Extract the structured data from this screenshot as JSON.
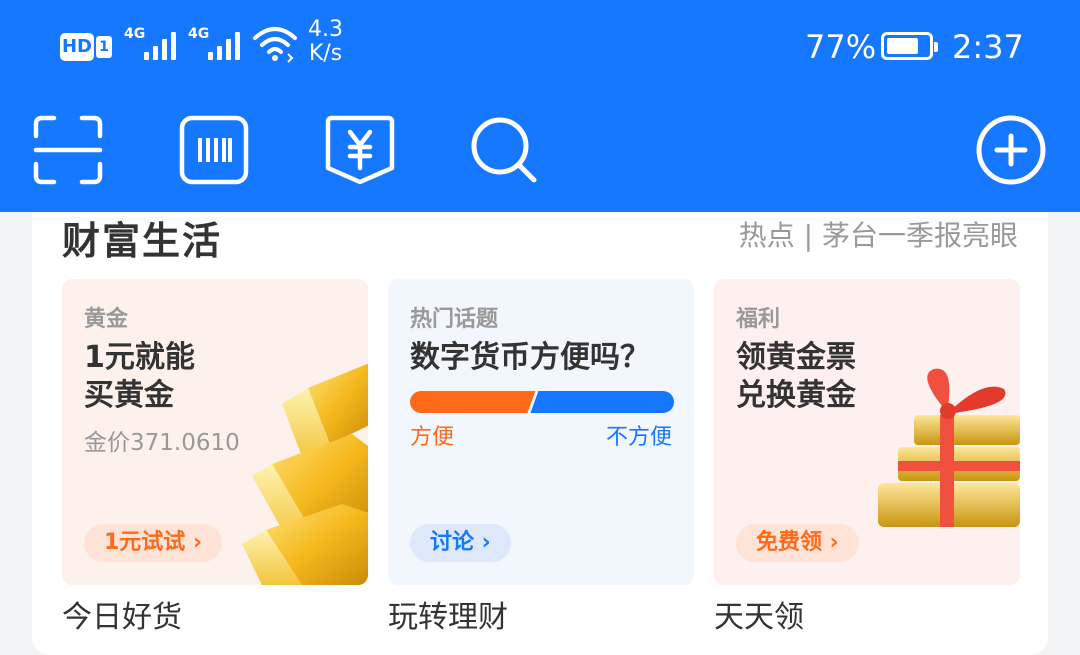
{
  "status_bar": {
    "hd": "HD",
    "hd_sub": "1",
    "net1": "4G",
    "net2": "4G",
    "speed_value": "4.3",
    "speed_unit": "K/s",
    "battery": "77%",
    "battery_level": 0.77,
    "time": "2:37"
  },
  "toolbar": {
    "icons": [
      "scan-icon",
      "barcode-icon",
      "payment-code-icon",
      "search-icon",
      "add-icon"
    ]
  },
  "section": {
    "title": "财富生活",
    "hot_text": "热点 | 茅台一季报亮眼"
  },
  "tiles": [
    {
      "category": "黄金",
      "title_line1": "1元就能",
      "title_line2": "买黄金",
      "subtitle": "金价371.0610",
      "action": "1元试试",
      "label": "今日好货"
    },
    {
      "category": "热门话题",
      "title_line1": "数字货币方便吗？",
      "vote_left": "方便",
      "vote_right": "不方便",
      "vote_left_share": 0.46,
      "action": "讨论",
      "label": "玩转理财"
    },
    {
      "category": "福利",
      "title_line1": "领黄金票",
      "title_line2": "兑换黄金",
      "action": "免费领",
      "label": "天天领"
    }
  ],
  "colors": {
    "brand_blue": "#1677ff",
    "orange": "#ff6a1a",
    "gold_tile_bg": "#fdf1eb",
    "topic_tile_bg": "#f2f6fd",
    "gift_tile_bg": "#fef0ee"
  }
}
